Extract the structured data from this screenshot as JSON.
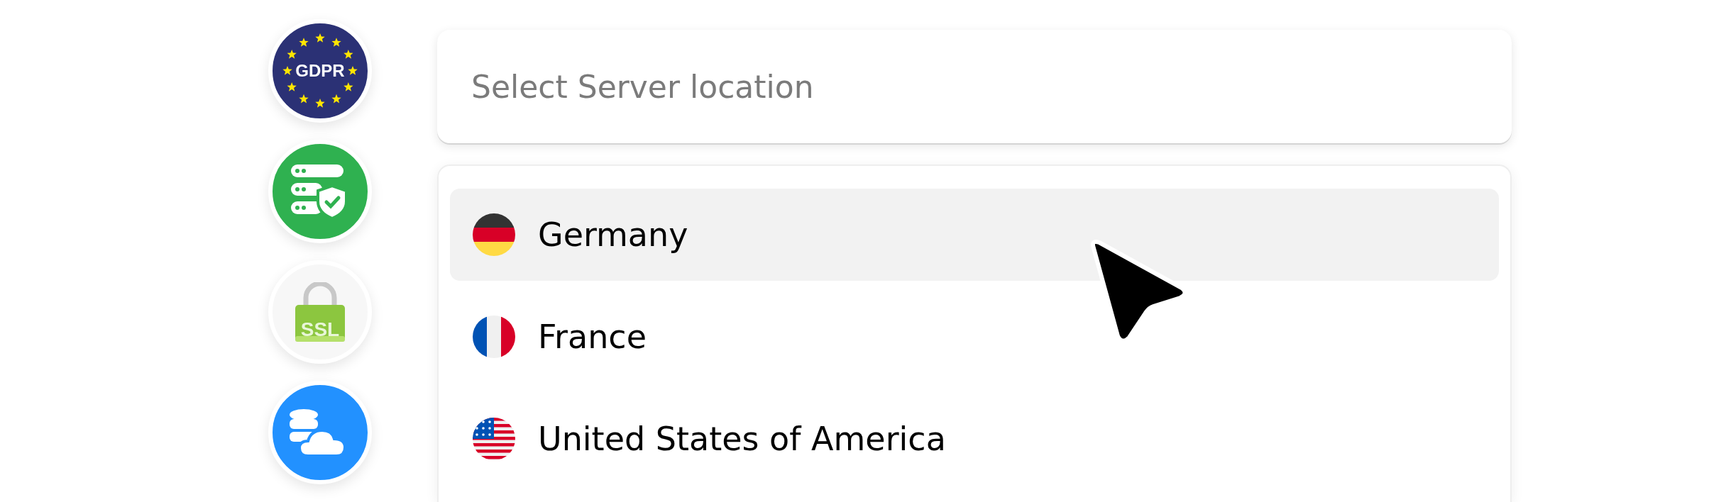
{
  "badges": [
    {
      "kind": "gdpr",
      "label": "GDPR"
    },
    {
      "kind": "server"
    },
    {
      "kind": "ssl",
      "label": "SSL"
    },
    {
      "kind": "cloud"
    }
  ],
  "search": {
    "placeholder": "Select Server location"
  },
  "options": [
    {
      "kind": "de",
      "label": "Germany",
      "selected": true
    },
    {
      "kind": "fr",
      "label": "France",
      "selected": false
    },
    {
      "kind": "us",
      "label": "United States of America",
      "selected": false
    }
  ]
}
